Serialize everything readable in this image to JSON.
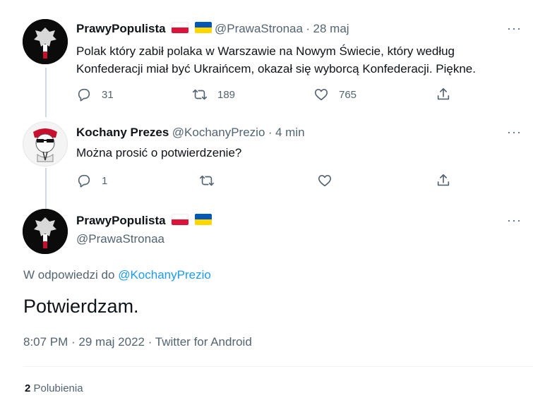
{
  "tweet1": {
    "name": "PrawyPopulista",
    "handle": "@PrawaStronaa",
    "sep": "·",
    "time": "28 maj",
    "text_line1": "Polak który zabił polaka w Warszawie na Nowym Świecie, który według",
    "text_line2": "Konfederacji miał być Ukraińcem, okazał się wyborcą Konfederacji. Piękne.",
    "replies": "31",
    "retweets": "189",
    "likes": "765",
    "more": "···"
  },
  "tweet2": {
    "name": "Kochany Prezes",
    "handle": "@KochanyPrezio",
    "sep": "·",
    "time": "4 min",
    "text": "Można prosić o potwierdzenie?",
    "replies": "1",
    "more": "···"
  },
  "main": {
    "name": "PrawyPopulista",
    "handle": "@PrawaStronaa",
    "more": "···",
    "reply_prefix": "W odpowiedzi do",
    "reply_to": "@KochanyPrezio",
    "text": "Potwierdzam.",
    "timestamp": "8:07 PM · 29 maj 2022 · Twitter for Android",
    "likes_count": "2",
    "likes_label": "Polubienia"
  },
  "colors": {
    "accent": "#1d9bf0",
    "secondary_text": "#536471",
    "flag_pl_red": "#dc143c",
    "flag_ua_blue": "#0057b7",
    "flag_ua_yellow": "#ffd700"
  },
  "icons": [
    "reply-icon",
    "retweet-icon",
    "like-icon",
    "share-icon",
    "more-icon",
    "flag-poland-icon",
    "flag-ukraine-icon"
  ]
}
